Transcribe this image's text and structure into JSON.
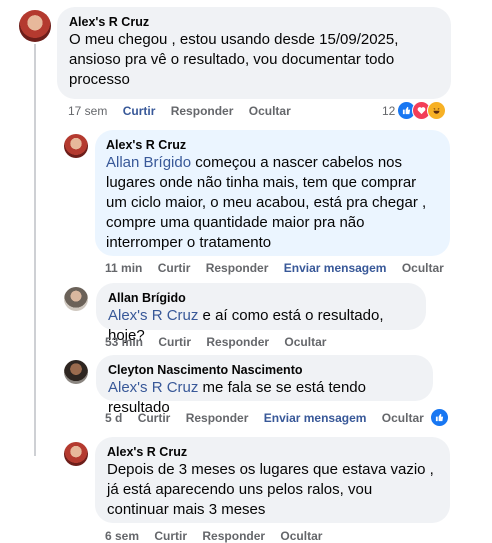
{
  "comments": [
    {
      "author": "Alex's R Cruz",
      "text": "O meu chegou , estou usando desde 15/09/2025, ansioso pra vê o resultado, vou documentar todo processo",
      "time": "17 sem",
      "like": "Curtir",
      "reply": "Responder",
      "hide": "Ocultar",
      "reaction_count": "12"
    },
    {
      "author": "Alex's R Cruz",
      "mention": "Allan Brígido",
      "text": " começou a nascer cabelos nos lugares onde não tinha mais, tem que comprar um ciclo maior, o meu acabou, está pra chegar , compre uma quantidade maior pra não interromper o tratamento",
      "time": "11 min",
      "like": "Curtir",
      "reply": "Responder",
      "message": "Enviar mensagem",
      "hide": "Ocultar"
    },
    {
      "author": "Allan Brígido",
      "mention": "Alex's R Cruz",
      "text": " e aí como está o resultado, hoje?",
      "time": "53 min",
      "like": "Curtir",
      "reply": "Responder",
      "hide": "Ocultar"
    },
    {
      "author": "Cleyton Nascimento Nascimento",
      "mention": "Alex's R Cruz",
      "text": " me fala se se está tendo resultado",
      "time": "5 d",
      "like": "Curtir",
      "reply": "Responder",
      "message": "Enviar mensagem",
      "hide": "Ocultar"
    },
    {
      "author": "Alex's R Cruz",
      "text": "Depois de 3 meses os lugares que estava vazio , já está aparecendo uns pelos ralos, vou continuar mais 3 meses",
      "time": "6 sem",
      "like": "Curtir",
      "reply": "Responder",
      "hide": "Ocultar"
    }
  ]
}
